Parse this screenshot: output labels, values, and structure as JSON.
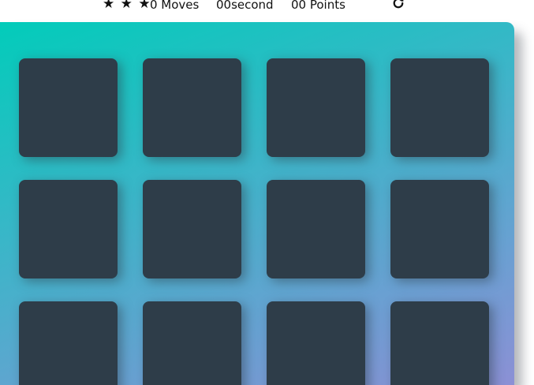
{
  "score_panel": {
    "stars": [
      "★",
      "★",
      "★"
    ],
    "moves": "0 Moves",
    "timer": "00second",
    "points": "00 Points",
    "restart_icon": "restart-icon"
  },
  "deck": {
    "gradient_start": "#02ccba",
    "gradient_end": "#8c90d5",
    "card_back_color": "#2e3d49",
    "cards_face_down": 12
  }
}
